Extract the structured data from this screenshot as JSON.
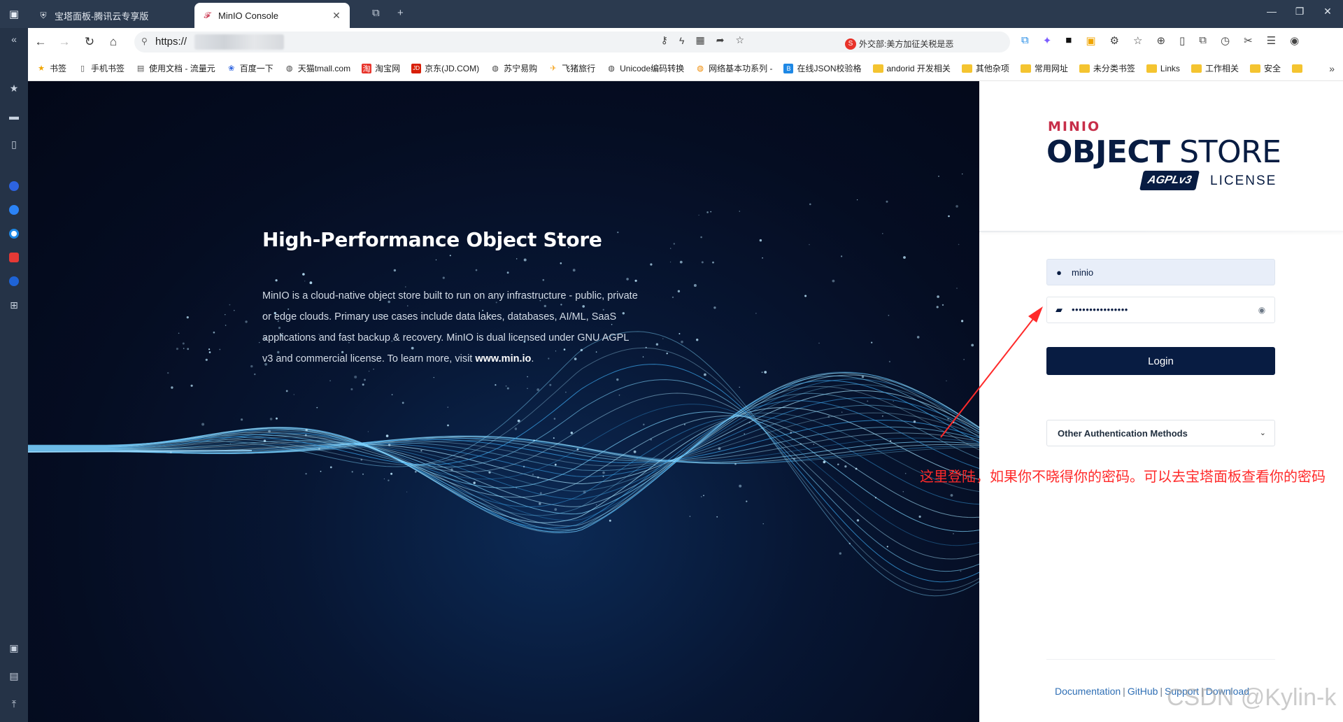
{
  "browser": {
    "tabs": [
      {
        "label": "宝塔面板-腾讯云专享版",
        "active": false,
        "icon": "shield-icon"
      },
      {
        "label": "MinIO Console",
        "active": true,
        "icon": "minio-flamingo-icon"
      }
    ],
    "url_prefix": "https://",
    "news_text": "外交部:美方加征关税是恶",
    "bookmarks": [
      {
        "label": "书签",
        "icon": "star-icon"
      },
      {
        "label": "手机书签",
        "icon": "phone-icon"
      },
      {
        "label": "使用文档 - 流量元",
        "icon": "doc-icon"
      },
      {
        "label": "百度一下",
        "icon": "baidu-paw-icon"
      },
      {
        "label": "天猫tmall.com",
        "icon": "globe-icon"
      },
      {
        "label": "淘宝网",
        "icon": "taobao-icon"
      },
      {
        "label": "京东(JD.COM)",
        "icon": "jd-icon"
      },
      {
        "label": "苏宁易购",
        "icon": "globe-icon"
      },
      {
        "label": "飞猪旅行",
        "icon": "fliggy-icon"
      },
      {
        "label": "Unicode编码转换",
        "icon": "globe-icon"
      },
      {
        "label": "网络基本功系列 -",
        "icon": "globe-icon"
      },
      {
        "label": "在线JSON校验格",
        "icon": "json-icon"
      },
      {
        "label": "andorid 开发相关",
        "icon": "folder-icon"
      },
      {
        "label": "其他杂项",
        "icon": "folder-icon"
      },
      {
        "label": "常用网址",
        "icon": "folder-icon"
      },
      {
        "label": "未分类书签",
        "icon": "folder-icon"
      },
      {
        "label": "Links",
        "icon": "folder-icon"
      },
      {
        "label": "工作相关",
        "icon": "folder-icon"
      },
      {
        "label": "安全",
        "icon": "folder-icon"
      }
    ]
  },
  "hero": {
    "title": "High-Performance Object Store",
    "desc_main": "MinIO is a cloud-native object store built to run on any infrastructure - public, private or edge clouds. Primary use cases include data lakes, databases, AI/ML, SaaS applications and fast backup & recovery. MinIO is dual licensed under GNU AGPL v3 and commercial license. To learn more, visit ",
    "desc_link": "www.min.io",
    "desc_end": "."
  },
  "login": {
    "logo_brand": "MINIO",
    "logo_object": "OBJECT",
    "logo_store": " STORE",
    "logo_agpl": "AGPLv3",
    "logo_license": "LICENSE",
    "username_value": "minio",
    "password_masked": "••••••••••••••••",
    "login_label": "Login",
    "other_auth_label": "Other Authentication Methods",
    "footer": {
      "documentation": "Documentation",
      "github": "GitHub",
      "support": "Support",
      "download": "Download"
    }
  },
  "annotation": {
    "text": "这里登陆，如果你不晓得你的密码。可以去宝塔面板查看你的密码",
    "color": "#ff2a2a"
  },
  "watermark": "CSDN @Kylin-k",
  "colors": {
    "navy": "#081c42",
    "minio_red": "#c72e49",
    "link_blue": "#2f6fb5"
  }
}
